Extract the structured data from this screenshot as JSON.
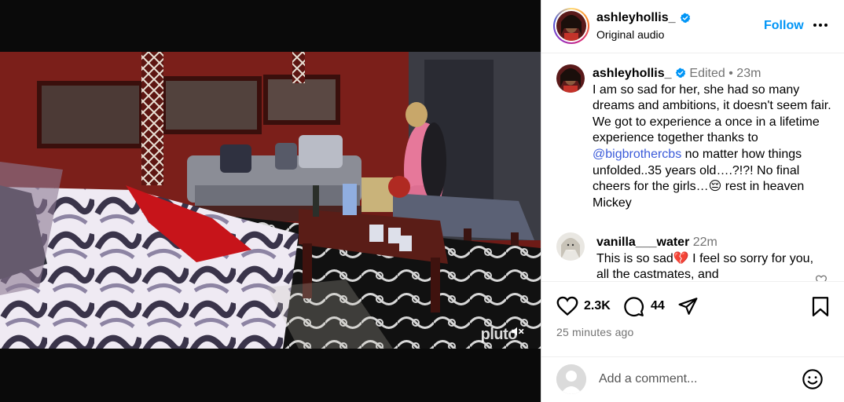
{
  "video": {
    "watermark": "pluto",
    "mute_icon": "speaker-muted-icon"
  },
  "post_header": {
    "username": "ashleyhollis_",
    "subtitle": "Original audio",
    "follow_label": "Follow",
    "more_icon": "more-horizontal-icon"
  },
  "caption": {
    "username": "ashleyhollis_",
    "edited": "Edited",
    "separator": "•",
    "time": "23m",
    "text_part1": "I am so sad for her, she had so many dreams and ambitions, it doesn't seem fair. We got to experience a once in a lifetime experience together thanks to ",
    "mention": "@bigbrothercbs",
    "text_part2": " no matter how things unfolded..35 years old….?!?! No final cheers for the girls…😔 rest in heaven Mickey"
  },
  "comment": {
    "username": "vanilla___water",
    "time": "22m",
    "text": "This is so sad💔 I feel so sorry for you, all the castmates, and"
  },
  "actions": {
    "like_icon": "heart-icon",
    "likes": "2.3K",
    "comment_icon": "comment-icon",
    "comments": "44",
    "share_icon": "send-icon",
    "save_icon": "bookmark-icon",
    "time_ago": "25 minutes ago"
  },
  "add_comment": {
    "placeholder": "Add a comment...",
    "emoji_icon": "smiley-icon"
  },
  "colors": {
    "link": "#0095f6",
    "mention": "#3b5bd9",
    "verified": "#0095f6",
    "muted": "#737373"
  }
}
